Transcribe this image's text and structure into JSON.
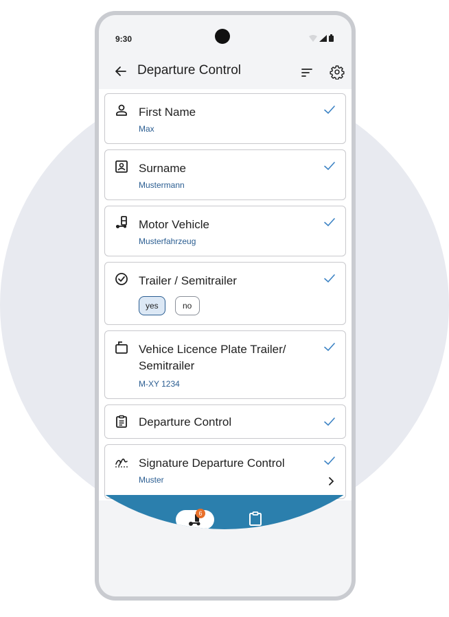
{
  "status": {
    "time": "9:30"
  },
  "appbar": {
    "title": "Departure Control"
  },
  "items": [
    {
      "label": "First Name",
      "value": "Max",
      "icon": "person-icon"
    },
    {
      "label": "Surname",
      "value": "Mustermann",
      "icon": "id-card-icon"
    },
    {
      "label": "Motor Vehicle",
      "value": "Musterfahrzeug",
      "icon": "vehicle-icon"
    },
    {
      "label": "Trailer / Semitrailer",
      "options": [
        "yes",
        "no"
      ],
      "selected": "yes",
      "icon": "check-circle-icon"
    },
    {
      "label_line1": "Vehice Licence Plate Trailer/",
      "label_line2": "Semitrailer",
      "value": "M-XY 1234",
      "icon": "license-plate-icon"
    },
    {
      "label": "Departure Control",
      "icon": "clipboard-list-icon"
    },
    {
      "label": "Signature Departure Control",
      "value": "Muster",
      "icon": "signature-icon"
    }
  ],
  "nav": {
    "badge": "6"
  },
  "colors": {
    "accent": "#2a5d91",
    "check": "#3b82c4",
    "bottom_bar": "#2b7fad",
    "badge": "#e8702a",
    "background_circle": "#e8eaf0"
  }
}
